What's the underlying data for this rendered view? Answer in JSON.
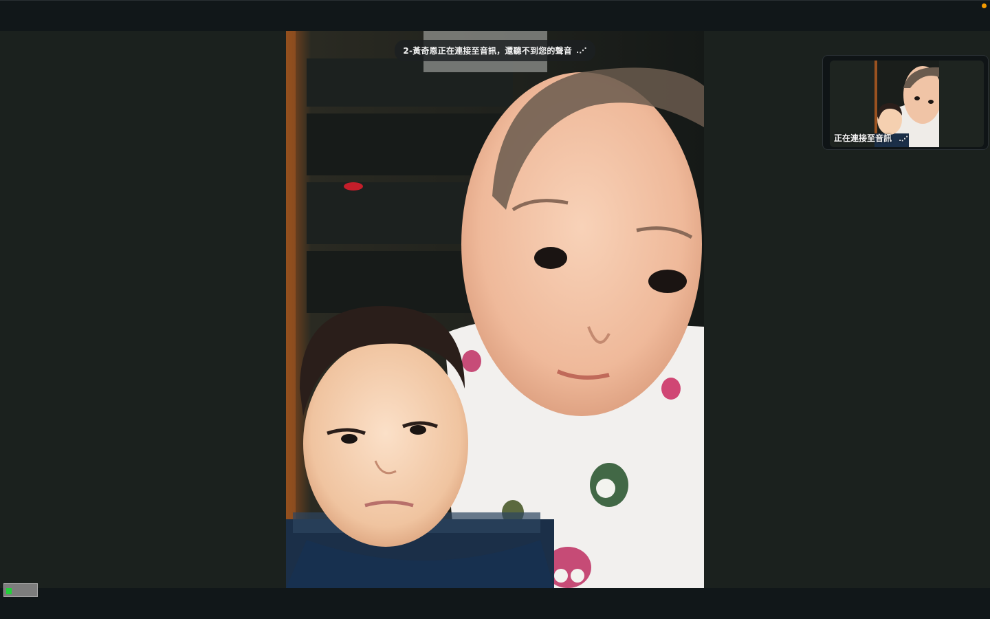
{
  "meeting": {
    "connecting_toast": "2-黃奇恩正在連接至音訊，還聽不到您的聲音",
    "toast_loader": ".⋰",
    "self_view_label": "正在連接至音訊",
    "self_view_loader": ".⋰"
  },
  "icons": {
    "status_dot": "recording-indicator-icon",
    "network": "network-quality-icon",
    "loader": "loading-dots-icon"
  },
  "colors": {
    "status_dot": "#f59b00",
    "stage_background": "#1b211e",
    "bars_background": "#111719",
    "network_bar": "#22d13a"
  }
}
